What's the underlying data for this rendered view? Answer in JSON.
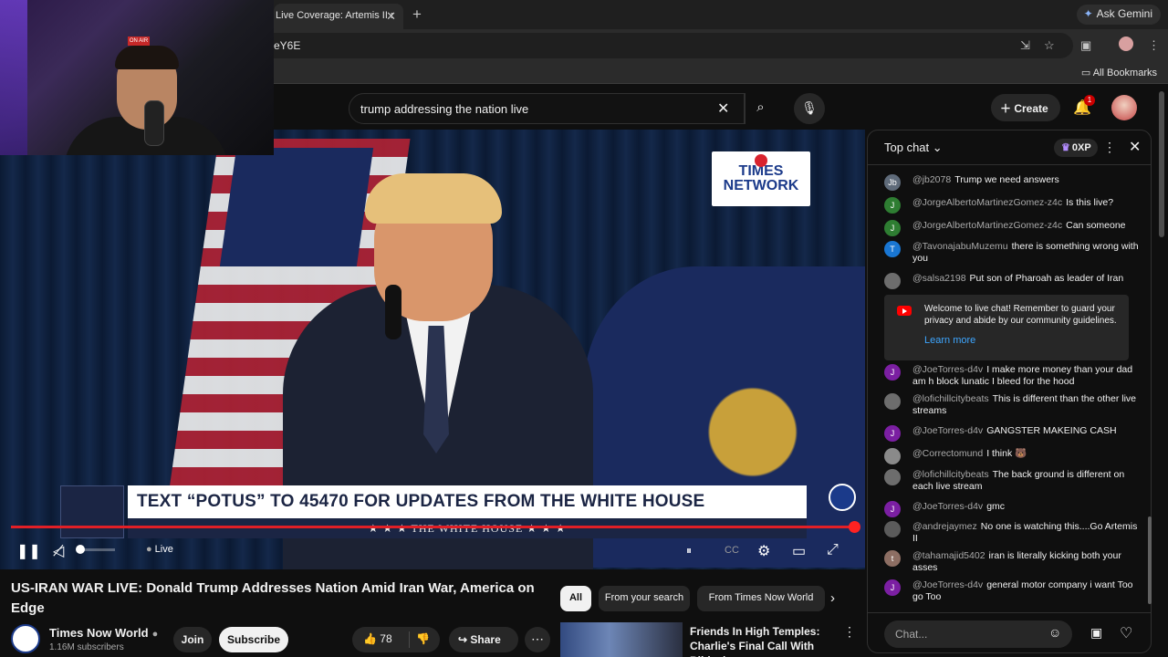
{
  "browser": {
    "tab_title": "Live Coverage: Artemis II r",
    "tab_close": "✕",
    "new_tab": "+",
    "ask_gemini": "Ask Gemini",
    "url_fragment": "eY6E",
    "all_bookmarks": "All Bookmarks"
  },
  "youtube": {
    "search_query": "trump addressing the nation live",
    "create_label": "Create",
    "notification_count": "1"
  },
  "video": {
    "brand_top": "TIMES",
    "brand_bottom": "NETWORK",
    "lower_third": "TEXT “POTUS” TO 45470 FOR UPDATES FROM THE WHITE HOUSE",
    "lower_third_band": "★ ★ ★  THE WHITE HOUSE  ★ ★ ★",
    "live_label": "Live",
    "progress": 1.0,
    "volume": 0.0
  },
  "details": {
    "title": "US-IRAN WAR LIVE: Donald Trump Addresses Nation Amid Iran War, America on Edge",
    "channel": "Times Now World",
    "subscribers": "1.16M subscribers",
    "join": "Join",
    "subscribe": "Subscribe",
    "likes": "78",
    "share": "Share"
  },
  "chips": [
    "All",
    "From your search",
    "From Times Now World"
  ],
  "recommendation": {
    "title": "Friends In High Temples: Charlie's Final Call With Bibi... |..."
  },
  "chat": {
    "mode": "Top chat",
    "xp": "0XP",
    "input_placeholder": "Chat...",
    "welcome_text": "Welcome to live chat! Remember to guard your privacy and abide by our community guidelines.",
    "learn_more": "Learn more",
    "messages_top": [
      {
        "initial": "Jb",
        "color": "#5f6b7a",
        "author": "@jb2078",
        "text": "Trump we need answers"
      },
      {
        "initial": "J",
        "color": "#2e7d32",
        "author": "@JorgeAlbertoMartinezGomez-z4c",
        "text": "Is this live?"
      },
      {
        "initial": "J",
        "color": "#2e7d32",
        "author": "@JorgeAlbertoMartinezGomez-z4c",
        "text": "Can someone"
      },
      {
        "initial": "T",
        "color": "#1976d2",
        "author": "@TavonajabuMuzemu",
        "text": "there is something wrong with you"
      },
      {
        "initial": "",
        "color": "#6d6d6d",
        "author": "@salsa2198",
        "text": "Put son of Pharoah as leader of Iran"
      }
    ],
    "messages_bottom": [
      {
        "initial": "J",
        "color": "#7b1fa2",
        "author": "@JoeTorres-d4v",
        "text": "I make more money than your dad am h block lunatic I bleed for the hood"
      },
      {
        "initial": "",
        "color": "#6d6d6d",
        "author": "@lofichillcitybeats",
        "text": "This is different than the other live streams"
      },
      {
        "initial": "J",
        "color": "#7b1fa2",
        "author": "@JoeTorres-d4v",
        "text": "GANGSTER MAKEING CASH"
      },
      {
        "initial": "",
        "color": "#8a8a8a",
        "author": "@Correctomund",
        "text": "I think 🐻"
      },
      {
        "initial": "",
        "color": "#6d6d6d",
        "author": "@lofichillcitybeats",
        "text": "The back ground is different on each live stream"
      },
      {
        "initial": "J",
        "color": "#7b1fa2",
        "author": "@JoeTorres-d4v",
        "text": "gmc"
      },
      {
        "initial": "",
        "color": "#5b5b5b",
        "author": "@andrejaymez",
        "text": "No one is watching this....Go Artemis II"
      },
      {
        "initial": "t",
        "color": "#8d6e63",
        "author": "@tahamajid5402",
        "text": "iran is literally kicking both your asses"
      },
      {
        "initial": "J",
        "color": "#7b1fa2",
        "author": "@JoeTorres-d4v",
        "text": "general motor company i want Too go Too"
      }
    ]
  }
}
